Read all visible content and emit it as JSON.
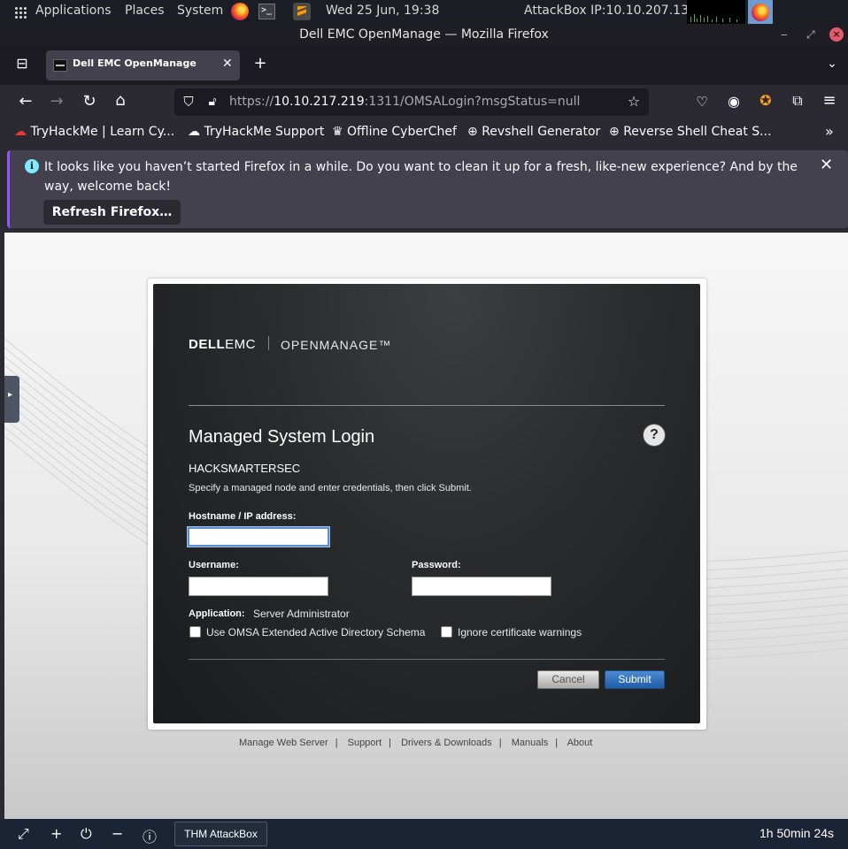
{
  "system_panel": {
    "applications": "Applications",
    "places": "Places",
    "system": "System",
    "datetime": "Wed 25 Jun, 19:38",
    "attackbox_ip": "AttackBox IP:10.10.207.139"
  },
  "window": {
    "title": "Dell EMC OpenManage — Mozilla Firefox"
  },
  "tab": {
    "label": "Dell EMC OpenManage"
  },
  "urlbar": {
    "prefix": "https://",
    "host": "10.10.217.219",
    "suffix": ":1311/OMSALogin?msgStatus=null"
  },
  "bookmarks": [
    "TryHackMe | Learn Cy...",
    "TryHackMe Support",
    "Offline CyberChef",
    "Revshell Generator",
    "Reverse Shell Cheat S..."
  ],
  "notification": {
    "message": "It looks like you haven’t started Firefox in a while. Do you want to clean it up for a fresh, like-new experience? And by the way, welcome back!",
    "button": "Refresh Firefox…"
  },
  "login": {
    "brand_dell": "DELL",
    "brand_emc": "EMC",
    "brand_product": "OPENMANAGE™",
    "title": "Managed System Login",
    "help": "?",
    "hostname_display": "HACKSMARTERSEC",
    "instructions": "Specify a managed node and enter credentials, then click Submit.",
    "hostname_label": "Hostname / IP address:",
    "hostname_value": "",
    "username_label": "Username:",
    "username_value": "",
    "password_label": "Password:",
    "password_value": "",
    "application_label": "Application:",
    "application_value": "Server Administrator",
    "checkbox_ad": "Use OMSA Extended Active Directory Schema",
    "checkbox_cert": "Ignore certificate warnings",
    "cancel": "Cancel",
    "submit": "Submit"
  },
  "footer_links": [
    "Manage Web Server",
    "Support",
    "Drivers & Downloads",
    "Manuals",
    "About"
  ],
  "bottom_bar": {
    "attackbox_button": "THM AttackBox",
    "timer": "1h 50min 24s"
  }
}
